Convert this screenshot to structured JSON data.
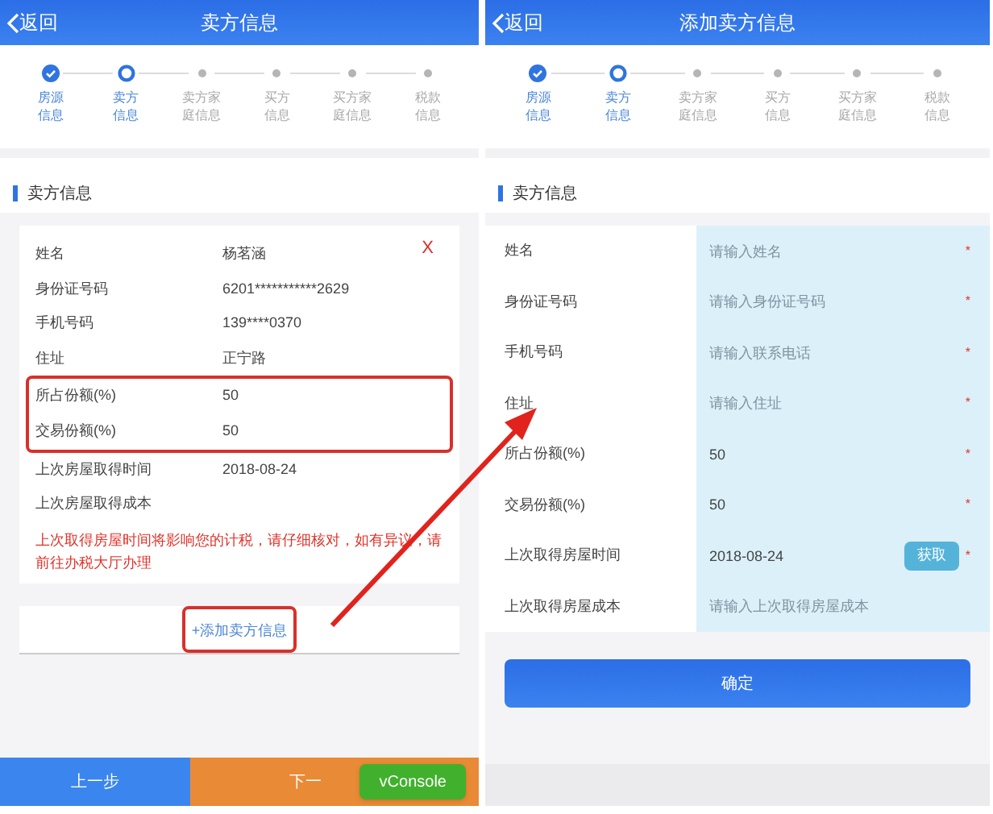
{
  "screens": [
    {
      "kind": "detail",
      "back": "返回",
      "title": "卖方信息",
      "steps": [
        {
          "lines": [
            "房源",
            "信息"
          ],
          "done": true,
          "selected": false
        },
        {
          "lines": [
            "卖方",
            "信息"
          ],
          "done": false,
          "selected": true
        },
        {
          "lines": [
            "卖方家",
            "庭信息"
          ],
          "done": false,
          "selected": false
        },
        {
          "lines": [
            "买方",
            "信息"
          ],
          "done": false,
          "selected": false
        },
        {
          "lines": [
            "买方家",
            "庭信息"
          ],
          "done": false,
          "selected": false
        },
        {
          "lines": [
            "税款",
            "信息"
          ],
          "done": false,
          "selected": false
        }
      ],
      "section": "卖方信息",
      "close": "X",
      "fields": [
        {
          "label": "姓名",
          "value": "杨茗涵",
          "highlighted": false
        },
        {
          "label": "身份证号码",
          "value": "6201***********2629",
          "highlighted": false
        },
        {
          "label": "手机号码",
          "value": "139****0370",
          "highlighted": false
        },
        {
          "label": "住址",
          "value": "正宁路",
          "highlighted": false
        },
        {
          "label": "所占份额(%)",
          "value": "50",
          "highlighted": true
        },
        {
          "label": "交易份额(%)",
          "value": "50",
          "highlighted": true
        },
        {
          "label": "上次房屋取得时间",
          "value": "2018-08-24",
          "highlighted": false
        },
        {
          "label": "上次房屋取得成本",
          "highlighted": false
        }
      ],
      "warning": "上次取得房屋时间将影响您的计税，请仔细核对，如有异议，请前往办税大厅办理",
      "add_link": {
        "label": "+添加卖方信息",
        "highlighted": true
      },
      "buttons": [
        {
          "label": "上一步",
          "kind": "prev"
        },
        {
          "label": "下一",
          "kind": "next"
        }
      ],
      "overlay_button": "vConsole"
    },
    {
      "kind": "form",
      "back": "返回",
      "title": "添加卖方信息",
      "steps": [
        {
          "lines": [
            "房源",
            "信息"
          ],
          "done": true,
          "selected": false
        },
        {
          "lines": [
            "卖方",
            "信息"
          ],
          "done": false,
          "selected": true
        },
        {
          "lines": [
            "卖方家",
            "庭信息"
          ],
          "done": false,
          "selected": false
        },
        {
          "lines": [
            "买方",
            "信息"
          ],
          "done": false,
          "selected": false
        },
        {
          "lines": [
            "买方家",
            "庭信息"
          ],
          "done": false,
          "selected": false
        },
        {
          "lines": [
            "税款",
            "信息"
          ],
          "done": false,
          "selected": false
        }
      ],
      "section": "卖方信息",
      "fields": [
        {
          "label": "姓名",
          "placeholder": "请输入姓名",
          "mark": "*"
        },
        {
          "label": "身份证号码",
          "placeholder": "请输入身份证号码",
          "mark": "*"
        },
        {
          "label": "手机号码",
          "placeholder": "请输入联系电话",
          "mark": "*"
        },
        {
          "label": "住址",
          "placeholder": "请输入住址",
          "mark": "*"
        },
        {
          "label": "所占份额(%)",
          "value": "50",
          "mark": "*"
        },
        {
          "label": "交易份额(%)",
          "value": "50",
          "mark": "*"
        },
        {
          "label": "上次取得房屋时间",
          "value": "2018-08-24",
          "action": "获取",
          "mark": "*"
        },
        {
          "label": "上次取得房屋成本",
          "placeholder": "请输入上次取得房屋成本"
        }
      ],
      "confirm": "确定"
    }
  ]
}
